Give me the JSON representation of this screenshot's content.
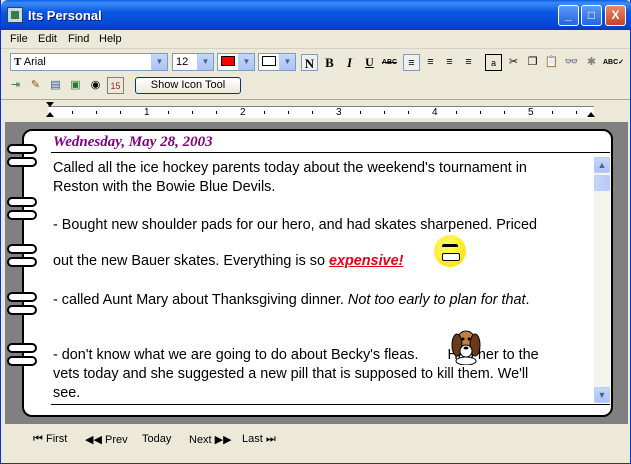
{
  "window": {
    "title": "Its Personal",
    "minimize_label": "_",
    "maximize_label": "□",
    "close_label": "X"
  },
  "menu": {
    "items": [
      "File",
      "Edit",
      "Find",
      "Help"
    ]
  },
  "toolbar": {
    "font_name": "Arial",
    "font_size": "12",
    "color_hex": "#ff0000",
    "bold_label": "B",
    "italic_label": "I",
    "underline_label": "U",
    "strike_label": "ABC",
    "normal_label": "N"
  },
  "toolbar2": {
    "show_icon_tool_label": "Show Icon Tool"
  },
  "ruler": {
    "numbers": [
      "1",
      "2",
      "3",
      "4",
      "5"
    ]
  },
  "entry": {
    "date": "Wednesday, May 28, 2003",
    "lines": {
      "l1": "Called all the ice hockey parents today about the weekend's tournament in",
      "l2": "Reston with the Bowie Blue Devils.",
      "l3": "- Bought new shoulder pads for our hero, and had skates sharpened. Priced",
      "l4a": "out the new Bauer skates. Everything is so ",
      "l4b": "expensive!",
      "l5a": "- called Aunt Mary about Thanksgiving dinner. ",
      "l5b": "Not too early to plan for that",
      "l5c": ".",
      "l6a": "- don't know what we are going to do about Becky's fleas.",
      "l6b": "Had her to the",
      "l7": "vets today and she suggested a new pill that is supposed to kill them. We'll",
      "l8": "see."
    }
  },
  "nav": {
    "first": "First",
    "prev": "Prev",
    "today": "Today",
    "next": "Next",
    "last": "Last"
  }
}
